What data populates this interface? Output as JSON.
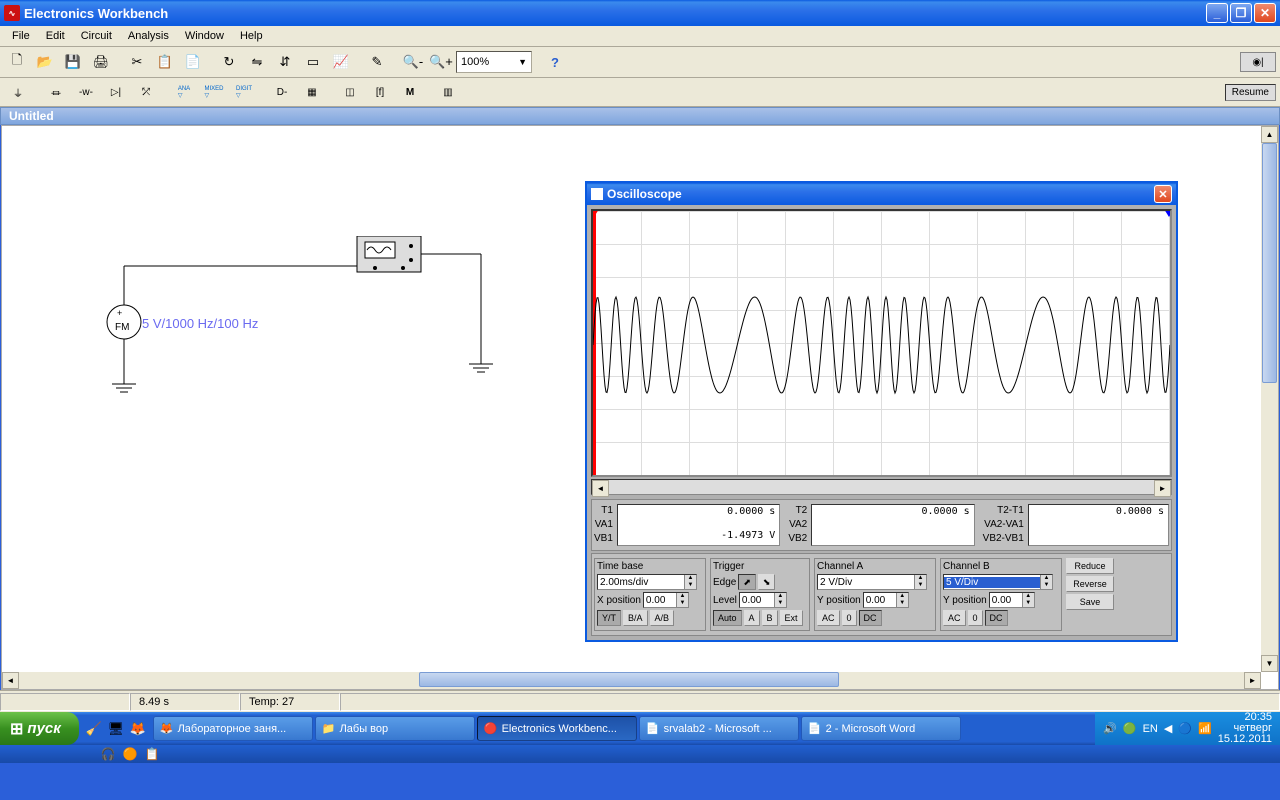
{
  "app": {
    "title": "Electronics Workbench"
  },
  "menu": [
    "File",
    "Edit",
    "Circuit",
    "Analysis",
    "Window",
    "Help"
  ],
  "zoom": "100%",
  "resume": "Resume",
  "doc_title": "Untitled",
  "circuit": {
    "fm_source_label": "5 V/1000 Hz/100 Hz",
    "fm_text": "FM"
  },
  "osc": {
    "title": "Oscilloscope",
    "readout": {
      "t1_label": "T1",
      "va1_label": "VA1",
      "vb1_label": "VB1",
      "t2_label": "T2",
      "va2_label": "VA2",
      "vb2_label": "VB2",
      "dt_label": "T2-T1",
      "dva_label": "VA2-VA1",
      "dvb_label": "VB2-VB1",
      "t1": "0.0000   s",
      "vb1": "-1.4973   V",
      "t2": "0.0000   s",
      "dt": "0.0000   s"
    },
    "timebase": {
      "hdr": "Time base",
      "value": "2.00ms/div",
      "xpos_label": "X position",
      "xpos": "0.00",
      "yt": "Y/T",
      "ba": "B/A",
      "ab": "A/B"
    },
    "trigger": {
      "hdr": "Trigger",
      "edge": "Edge",
      "level_label": "Level",
      "level": "0.00",
      "auto": "Auto",
      "a": "A",
      "b": "B",
      "ext": "Ext"
    },
    "chA": {
      "hdr": "Channel A",
      "scale": "2 V/Div",
      "ypos_label": "Y position",
      "ypos": "0.00",
      "ac": "AC",
      "zero": "0",
      "dc": "DC"
    },
    "chB": {
      "hdr": "Channel B",
      "scale": "5 V/Div",
      "ypos_label": "Y position",
      "ypos": "0.00",
      "ac": "AC",
      "zero": "0",
      "dc": "DC"
    },
    "side": {
      "reduce": "Reduce",
      "reverse": "Reverse",
      "save": "Save"
    }
  },
  "status": {
    "time": "8.49 s",
    "temp_label": "Temp:",
    "temp": "27"
  },
  "taskbar": {
    "start": "пуск",
    "tasks": [
      {
        "icon": "🦊",
        "label": "Лабораторное заня..."
      },
      {
        "icon": "📁",
        "label": "Лабы вор"
      },
      {
        "icon": "🔴",
        "label": "Electronics Workbenc...",
        "active": true
      },
      {
        "icon": "📄",
        "label": "srvalab2 - Microsoft ..."
      },
      {
        "icon": "📄",
        "label": "2 - Microsoft Word"
      }
    ],
    "lang": "EN",
    "time": "20:35",
    "day": "четверг",
    "date": "15.12.2011"
  }
}
